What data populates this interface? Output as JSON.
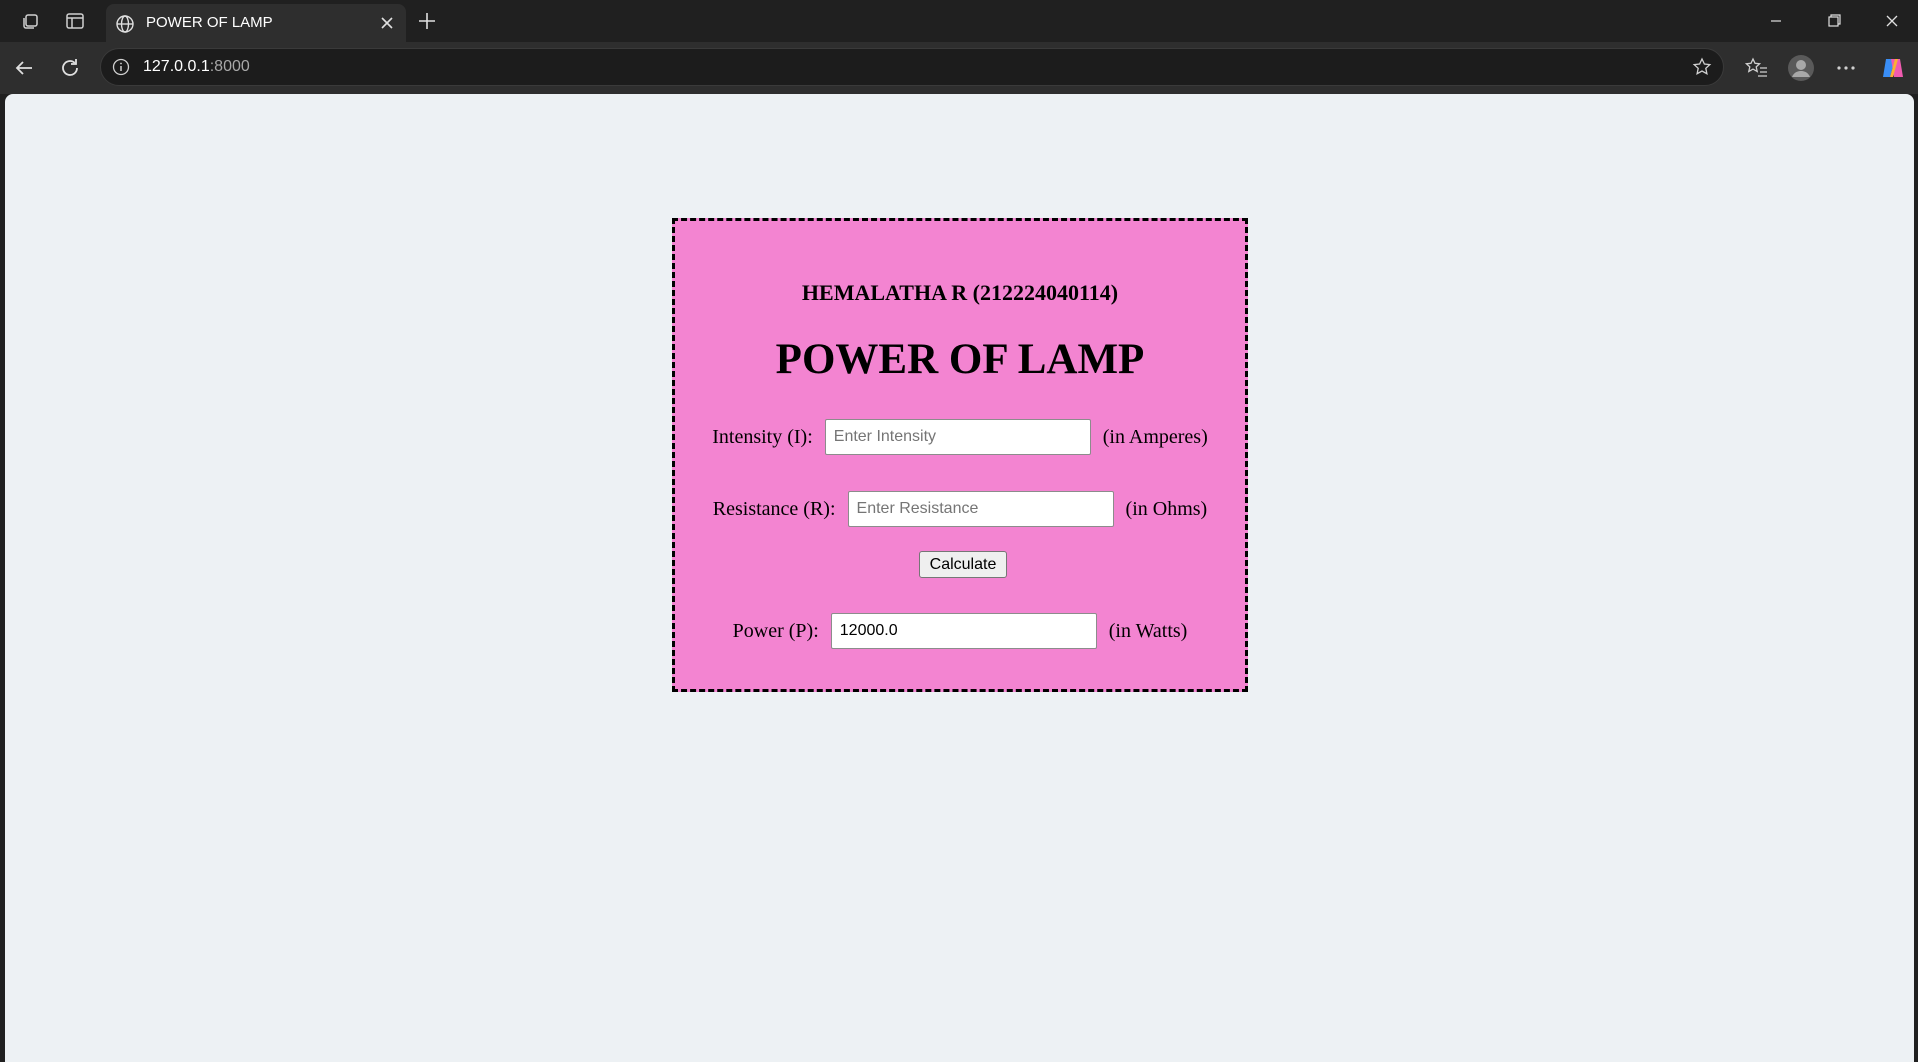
{
  "browser": {
    "tab_title": "POWER OF LAMP",
    "url_host": "127.0.0.1",
    "url_port": ":8000"
  },
  "page": {
    "author": "HEMALATHA R (212224040114)",
    "heading": "POWER OF LAMP",
    "intensity": {
      "label": "Intensity (I):",
      "placeholder": "Enter Intensity",
      "value": "",
      "unit": "(in Amperes)"
    },
    "resistance": {
      "label": "Resistance (R):",
      "placeholder": "Enter Resistance",
      "value": "",
      "unit": "(in Ohms)"
    },
    "calculate_label": "Calculate",
    "power": {
      "label": "Power (P):",
      "value": "12000.0",
      "unit": "(in Watts)"
    }
  },
  "colors": {
    "card_background": "#f384d1",
    "page_background": "#edf1f4",
    "browser_chrome": "#202020"
  },
  "icons": [
    "workspaces-icon",
    "vertical-tabs-icon",
    "globe-icon",
    "close-icon",
    "plus-icon",
    "minimize-icon",
    "restore-icon",
    "back-icon",
    "refresh-icon",
    "info-icon",
    "star-icon",
    "favorites-icon",
    "profile-icon",
    "more-icon",
    "copilot-icon"
  ]
}
